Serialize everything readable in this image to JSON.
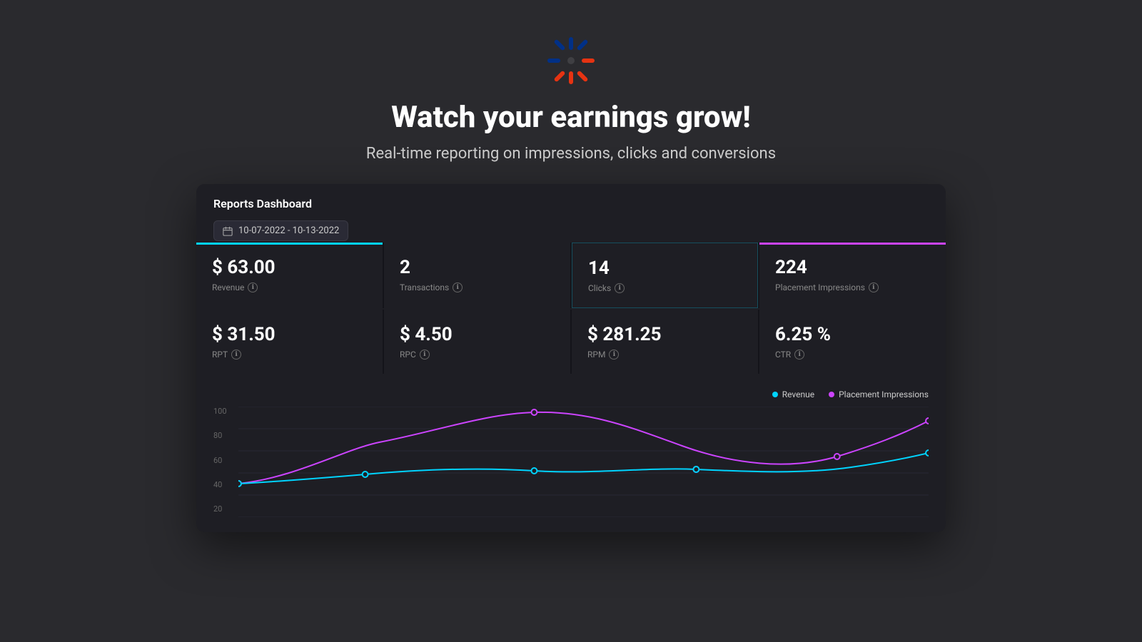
{
  "logo": {
    "alt": "Walmart Spark logo"
  },
  "hero": {
    "title": "Watch your earnings grow!",
    "subtitle": "Real-time reporting on impressions, clicks and conversions"
  },
  "dashboard": {
    "title": "Reports Dashboard",
    "date_range": "10-07-2022 - 10-13-2022",
    "metrics_top": [
      {
        "value": "$ 63.00",
        "label": "Revenue",
        "has_info": true,
        "style": "cyan"
      },
      {
        "value": "2",
        "label": "Transactions",
        "has_info": true,
        "style": "none"
      },
      {
        "value": "14",
        "label": "Clicks",
        "has_info": true,
        "style": "none"
      },
      {
        "value": "224",
        "label": "Placement Impressions",
        "has_info": true,
        "style": "purple"
      }
    ],
    "metrics_bottom": [
      {
        "value": "$ 31.50",
        "label": "RPT",
        "has_info": true
      },
      {
        "value": "$ 4.50",
        "label": "RPC",
        "has_info": true
      },
      {
        "value": "$ 281.25",
        "label": "RPM",
        "has_info": true
      },
      {
        "value": "6.25 %",
        "label": "CTR",
        "has_info": true
      }
    ],
    "chart": {
      "legend": [
        {
          "label": "Revenue",
          "color": "cyan"
        },
        {
          "label": "Placement Impressions",
          "color": "purple"
        }
      ],
      "y_labels": [
        "100",
        "80",
        "60",
        "40",
        "20"
      ],
      "info_icon_label": "ℹ"
    }
  }
}
